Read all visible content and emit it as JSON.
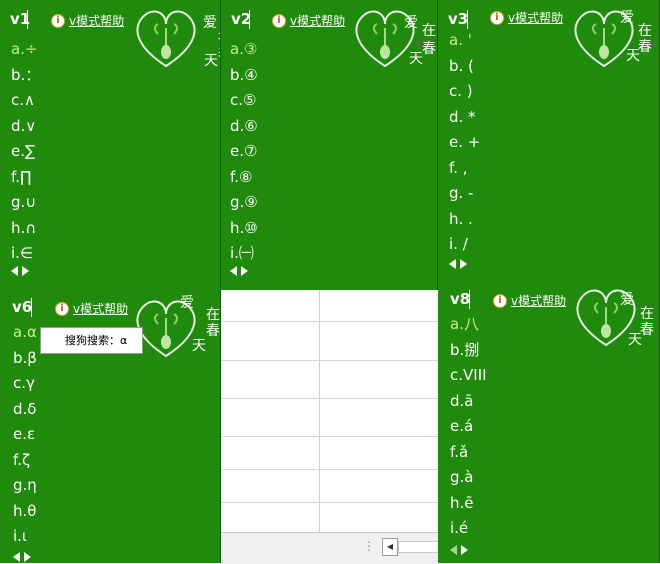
{
  "help_label": "v模式帮助",
  "help_icon": "info-icon",
  "deco_chars": [
    "爱",
    "在",
    "春",
    "天"
  ],
  "colors": {
    "panel_bg": "#1f8a0b",
    "text": "#ffffff",
    "selected": "#c8ee88"
  },
  "panels": {
    "v1": {
      "title": "v1",
      "items": [
        "a.÷",
        "b.：",
        "c.∧",
        "d.∨",
        "e.∑",
        "f.∏",
        "g.∪",
        "h.∩",
        "i.∈"
      ]
    },
    "v2": {
      "title": "v2",
      "items": [
        "a.③",
        "b.④",
        "c.⑤",
        "d.⑥",
        "e.⑦",
        "f.⑧",
        "g.⑨",
        "h.⑩",
        "i.㈠"
      ]
    },
    "v3": {
      "title": "v3",
      "items": [
        "a. '",
        "b. (",
        "c. )",
        "d. *",
        "e. +",
        "f. ,",
        "g. -",
        "h. .",
        "i. /"
      ]
    },
    "v6": {
      "title": "v6",
      "items": [
        "a.α",
        "b.β",
        "c.γ",
        "d.δ",
        "e.ε",
        "f.ζ",
        "g.η",
        "h.θ",
        "i.ι"
      ]
    },
    "v8": {
      "title": "v8",
      "items": [
        "a.八",
        "b.捌",
        "c.VIII",
        "d.ā",
        "e.á",
        "f.ǎ",
        "g.à",
        "h.ē",
        "i.é"
      ]
    }
  },
  "tooltip": {
    "text": "搜狗搜索：α"
  }
}
